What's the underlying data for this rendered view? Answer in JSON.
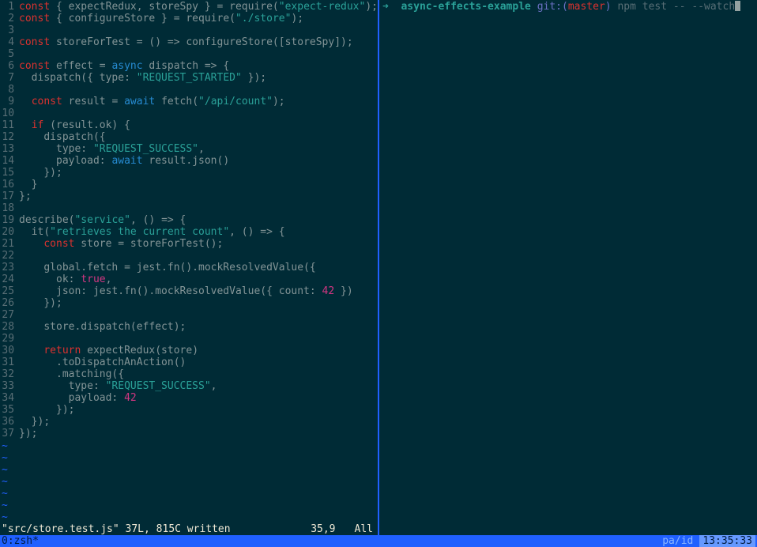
{
  "editor": {
    "status": {
      "file": "\"src/store.test.js\" 37L, 815C written",
      "pos": "35,9",
      "view": "All"
    },
    "lines": [
      {
        "n": 1,
        "seg": [
          [
            "kw",
            "const"
          ],
          [
            "pn",
            " { expectRedux, storeSpy } = require("
          ],
          [
            "str",
            "\"expect-redux\""
          ],
          [
            "pn",
            ");"
          ]
        ]
      },
      {
        "n": 2,
        "seg": [
          [
            "kw",
            "const"
          ],
          [
            "pn",
            " { configureStore } = require("
          ],
          [
            "str",
            "\"./store\""
          ],
          [
            "pn",
            ");"
          ]
        ]
      },
      {
        "n": 3,
        "seg": []
      },
      {
        "n": 4,
        "seg": [
          [
            "kw",
            "const"
          ],
          [
            "pn",
            " storeForTest = () => configureStore([storeSpy]);"
          ]
        ]
      },
      {
        "n": 5,
        "seg": []
      },
      {
        "n": 6,
        "seg": [
          [
            "kw",
            "const"
          ],
          [
            "pn",
            " effect = "
          ],
          [
            "fn",
            "async"
          ],
          [
            "pn",
            " dispatch => {"
          ]
        ]
      },
      {
        "n": 7,
        "seg": [
          [
            "pn",
            "  dispatch({ type: "
          ],
          [
            "str",
            "\"REQUEST_STARTED\""
          ],
          [
            "pn",
            " });"
          ]
        ]
      },
      {
        "n": 8,
        "seg": []
      },
      {
        "n": 9,
        "seg": [
          [
            "pn",
            "  "
          ],
          [
            "kw",
            "const"
          ],
          [
            "pn",
            " result = "
          ],
          [
            "fn",
            "await"
          ],
          [
            "pn",
            " fetch("
          ],
          [
            "str",
            "\"/api/count\""
          ],
          [
            "pn",
            ");"
          ]
        ]
      },
      {
        "n": 10,
        "seg": []
      },
      {
        "n": 11,
        "seg": [
          [
            "pn",
            "  "
          ],
          [
            "kw",
            "if"
          ],
          [
            "pn",
            " (result.ok) {"
          ]
        ]
      },
      {
        "n": 12,
        "seg": [
          [
            "pn",
            "    dispatch({"
          ]
        ]
      },
      {
        "n": 13,
        "seg": [
          [
            "pn",
            "      type: "
          ],
          [
            "str",
            "\"REQUEST_SUCCESS\""
          ],
          [
            "pn",
            ","
          ]
        ]
      },
      {
        "n": 14,
        "seg": [
          [
            "pn",
            "      payload: "
          ],
          [
            "fn",
            "await"
          ],
          [
            "pn",
            " result.json()"
          ]
        ]
      },
      {
        "n": 15,
        "seg": [
          [
            "pn",
            "    });"
          ]
        ]
      },
      {
        "n": 16,
        "seg": [
          [
            "pn",
            "  }"
          ]
        ]
      },
      {
        "n": 17,
        "seg": [
          [
            "pn",
            "};"
          ]
        ]
      },
      {
        "n": 18,
        "seg": []
      },
      {
        "n": 19,
        "seg": [
          [
            "pn",
            "describe("
          ],
          [
            "str",
            "\"service\""
          ],
          [
            "pn",
            ", () => {"
          ]
        ]
      },
      {
        "n": 20,
        "seg": [
          [
            "pn",
            "  it("
          ],
          [
            "str",
            "\"retrieves the current count\""
          ],
          [
            "pn",
            ", () => {"
          ]
        ]
      },
      {
        "n": 21,
        "seg": [
          [
            "pn",
            "    "
          ],
          [
            "kw",
            "const"
          ],
          [
            "pn",
            " store = storeForTest();"
          ]
        ]
      },
      {
        "n": 22,
        "seg": []
      },
      {
        "n": 23,
        "seg": [
          [
            "pn",
            "    global.fetch = jest.fn().mockResolvedValue({"
          ]
        ]
      },
      {
        "n": 24,
        "seg": [
          [
            "pn",
            "      ok: "
          ],
          [
            "num",
            "true"
          ],
          [
            "pn",
            ","
          ]
        ]
      },
      {
        "n": 25,
        "seg": [
          [
            "pn",
            "      json: jest.fn().mockResolvedValue({ count: "
          ],
          [
            "num",
            "42"
          ],
          [
            "pn",
            " })"
          ]
        ]
      },
      {
        "n": 26,
        "seg": [
          [
            "pn",
            "    });"
          ]
        ]
      },
      {
        "n": 27,
        "seg": []
      },
      {
        "n": 28,
        "seg": [
          [
            "pn",
            "    store.dispatch(effect);"
          ]
        ]
      },
      {
        "n": 29,
        "seg": []
      },
      {
        "n": 30,
        "seg": [
          [
            "pn",
            "    "
          ],
          [
            "kw",
            "return"
          ],
          [
            "pn",
            " expectRedux(store)"
          ]
        ]
      },
      {
        "n": 31,
        "seg": [
          [
            "pn",
            "      .toDispatchAnAction()"
          ]
        ]
      },
      {
        "n": 32,
        "seg": [
          [
            "pn",
            "      .matching({"
          ]
        ]
      },
      {
        "n": 33,
        "seg": [
          [
            "pn",
            "        type: "
          ],
          [
            "str",
            "\"REQUEST_SUCCESS\""
          ],
          [
            "pn",
            ","
          ]
        ]
      },
      {
        "n": 34,
        "seg": [
          [
            "pn",
            "        payload: "
          ],
          [
            "num",
            "42"
          ]
        ]
      },
      {
        "n": 35,
        "seg": [
          [
            "pn",
            "      });"
          ]
        ]
      },
      {
        "n": 36,
        "seg": [
          [
            "pn",
            "  });"
          ]
        ]
      },
      {
        "n": 37,
        "seg": [
          [
            "pn",
            "});"
          ]
        ]
      }
    ],
    "tilde_rows": 7
  },
  "terminal": {
    "prompt": {
      "arrow": "➜",
      "dir": "async-effects-example",
      "git_label": "git:",
      "paren_open": "(",
      "branch": "master",
      "paren_close": ")",
      "command": "npm test -- --watch"
    }
  },
  "tmux": {
    "left": "0:zsh*",
    "mid": "pa/id",
    "clock": "13:35:33"
  }
}
